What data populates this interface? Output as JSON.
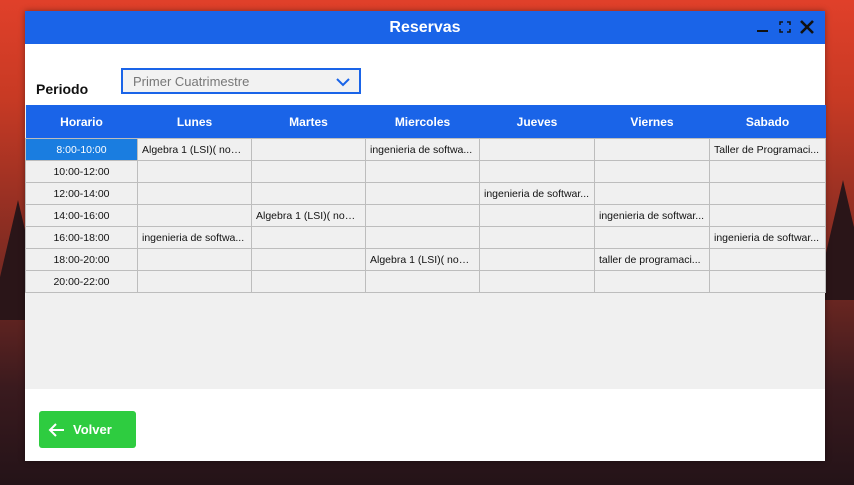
{
  "window": {
    "title": "Reservas"
  },
  "periodo": {
    "label": "Periodo",
    "selected": "Primer Cuatrimestre"
  },
  "schedule": {
    "headers": [
      "Horario",
      "Lunes",
      "Martes",
      "Miercoles",
      "Jueves",
      "Viernes",
      "Sabado"
    ],
    "rows": [
      [
        "8:00-10:00",
        "Algebra 1 (LSI)( nom...",
        "",
        "ingenieria de softwa...",
        "",
        "",
        "Taller de Programaci..."
      ],
      [
        "10:00-12:00",
        "",
        "",
        "",
        "",
        "",
        ""
      ],
      [
        "12:00-14:00",
        "",
        "",
        "",
        "ingenieria de softwar...",
        "",
        ""
      ],
      [
        "14:00-16:00",
        "",
        "Algebra 1 (LSI)( nom...",
        "",
        "",
        "ingenieria de softwar...",
        ""
      ],
      [
        "16:00-18:00",
        "ingenieria de softwa...",
        "",
        "",
        "",
        "",
        "ingenieria de softwar..."
      ],
      [
        "18:00-20:00",
        "",
        "",
        "Algebra 1 (LSI)( nom...",
        "",
        "taller de programaci...",
        ""
      ],
      [
        "20:00-22:00",
        "",
        "",
        "",
        "",
        "",
        ""
      ]
    ]
  },
  "footer": {
    "back_label": "Volver"
  },
  "colors": {
    "accent": "#1a64e8",
    "button": "#2ecc40",
    "selected": "#1a7de0"
  }
}
